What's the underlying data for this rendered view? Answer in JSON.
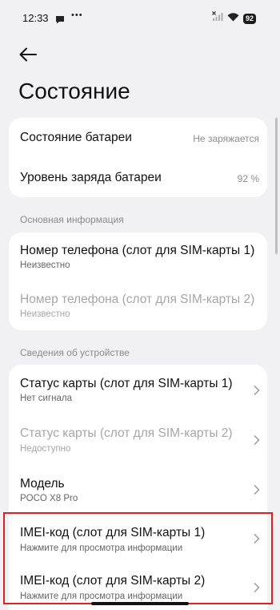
{
  "status_bar": {
    "time": "12:33",
    "dots": "•••",
    "battery": "92",
    "icons": [
      "chat-bubble-icon",
      "no-sim-signal-icon",
      "wifi-icon",
      "battery-icon"
    ]
  },
  "header": {
    "back_icon": "arrow-left-icon",
    "title": "Состояние"
  },
  "battery_card": {
    "items": [
      {
        "label": "Состояние батареи",
        "value": "Не заряжается"
      },
      {
        "label": "Уровень заряда батареи",
        "value": "92 %"
      }
    ]
  },
  "basic_info": {
    "header": "Основная информация",
    "items": [
      {
        "label": "Номер телефона (слот для SIM-карты 1)",
        "sub": "Неизвестно",
        "enabled": true
      },
      {
        "label": "Номер телефона (слот для SIM-карты 2)",
        "sub": "Неизвестно",
        "enabled": false
      }
    ]
  },
  "device_info": {
    "header": "Сведения об устройстве",
    "items": [
      {
        "label": "Статус карты (слот для SIM-карты 1)",
        "sub": "Нет сигнала",
        "enabled": true
      },
      {
        "label": "Статус карты (слот для SIM-карты 2)",
        "sub": "Недоступно",
        "enabled": false
      },
      {
        "label": "Модель",
        "sub": "POCO X8 Pro",
        "enabled": true
      },
      {
        "label": "IMEI-код (слот для SIM-карты 1)",
        "sub": "Нажмите для просмотра информации",
        "enabled": true
      },
      {
        "label": "IMEI-код (слот для SIM-карты 2)",
        "sub": "Нажмите для просмотра информации",
        "enabled": true
      }
    ]
  },
  "colors": {
    "background": "#f1f1f3",
    "card": "#ffffff",
    "highlight": "#e0201f",
    "disabled_text": "#a6a6a6"
  }
}
